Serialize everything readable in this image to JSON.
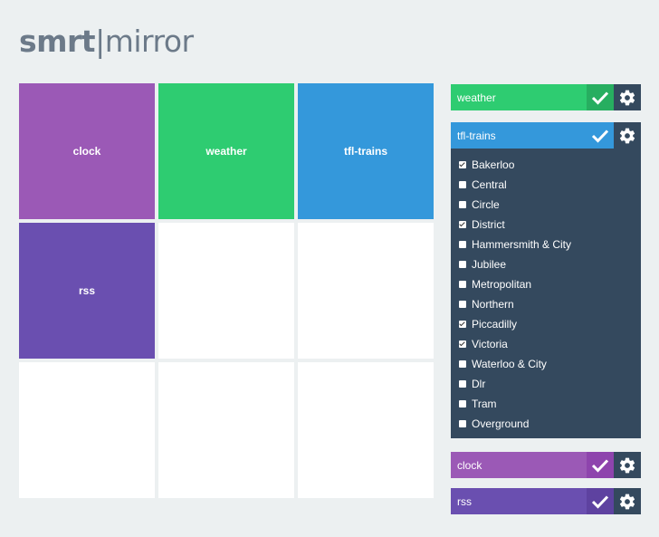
{
  "app": {
    "logo_part1": "smrt",
    "logo_sep": "|",
    "logo_part2": "mirror"
  },
  "grid": {
    "tiles": [
      {
        "label": "clock",
        "color": "#9b59b6"
      },
      {
        "label": "weather",
        "color": "#2ecc71"
      },
      {
        "label": "tfl-trains",
        "color": "#3498db"
      },
      {
        "label": "rss",
        "color": "#6a4fb0"
      },
      {
        "label": "",
        "color": "#ffffff"
      },
      {
        "label": "",
        "color": "#ffffff"
      },
      {
        "label": "",
        "color": "#ffffff"
      },
      {
        "label": "",
        "color": "#ffffff"
      },
      {
        "label": "",
        "color": "#ffffff"
      }
    ]
  },
  "modules": {
    "weather": {
      "label": "weather",
      "color": "#2ecc71",
      "check_color": "#27ae60",
      "check_icon": "check-icon",
      "settings_icon": "gear-icon"
    },
    "tfl": {
      "label": "tfl-trains",
      "color": "#3498db",
      "check_color": "#3498db",
      "check_icon": "check-icon",
      "settings_icon": "gear-icon",
      "lines": [
        {
          "name": "Bakerloo",
          "checked": true
        },
        {
          "name": "Central",
          "checked": false
        },
        {
          "name": "Circle",
          "checked": false
        },
        {
          "name": "District",
          "checked": true
        },
        {
          "name": "Hammersmith & City",
          "checked": false
        },
        {
          "name": "Jubilee",
          "checked": false
        },
        {
          "name": "Metropolitan",
          "checked": false
        },
        {
          "name": "Northern",
          "checked": false
        },
        {
          "name": "Piccadilly",
          "checked": true
        },
        {
          "name": "Victoria",
          "checked": true
        },
        {
          "name": "Waterloo & City",
          "checked": false
        },
        {
          "name": "Dlr",
          "checked": false
        },
        {
          "name": "Tram",
          "checked": false
        },
        {
          "name": "Overground",
          "checked": false
        }
      ]
    },
    "clock": {
      "label": "clock",
      "color": "#9b59b6",
      "check_color": "#8e44ad",
      "check_icon": "check-icon",
      "settings_icon": "gear-icon"
    },
    "rss": {
      "label": "rss",
      "color": "#6a4fb0",
      "check_color": "#5e42a0",
      "check_icon": "check-icon",
      "settings_icon": "gear-icon"
    }
  }
}
